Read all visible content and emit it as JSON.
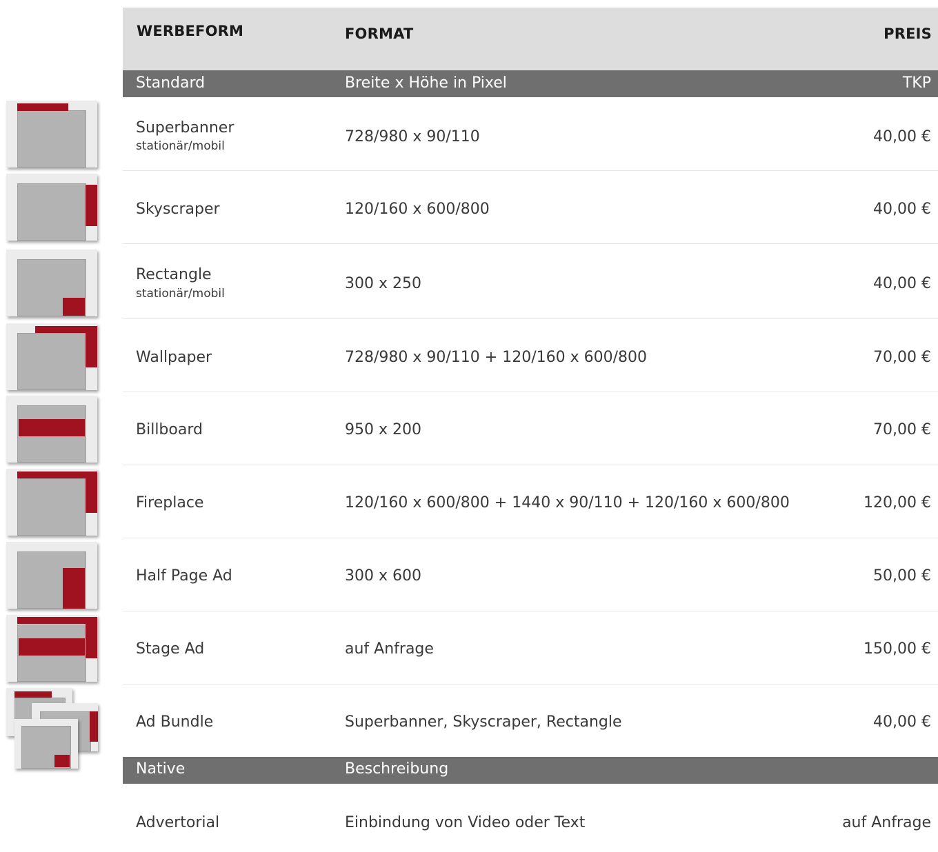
{
  "header": {
    "col1": "WERBEFORM",
    "col2": "FORMAT",
    "col3": "PREIS"
  },
  "sections": {
    "standard": {
      "label": "Standard",
      "format": "Breite x Höhe in Pixel",
      "price": "TKP"
    },
    "native": {
      "label": "Native",
      "format": "Beschreibung"
    }
  },
  "rows": [
    {
      "name": "Superbanner",
      "sub": "stationär/mobil",
      "format": "728/980 x 90/110",
      "price": "40,00 €"
    },
    {
      "name": "Skyscraper",
      "format": "120/160 x 600/800",
      "price": "40,00 €"
    },
    {
      "name": "Rectangle",
      "sub": "stationär/mobil",
      "format": "300 x 250",
      "price": "40,00 €"
    },
    {
      "name": "Wallpaper",
      "format": "728/980 x 90/110  +  120/160 x 600/800",
      "price": "70,00 €"
    },
    {
      "name": "Billboard",
      "format": "950 x 200",
      "price": "70,00 €"
    },
    {
      "name": " Fireplace",
      "format": "120/160 x 600/800  +  1440 x 90/110  +  120/160 x 600/800",
      "price": "120,00 €"
    },
    {
      "name": "Half Page Ad",
      "format": "300 x 600",
      "price": "50,00 €"
    },
    {
      "name": "Stage Ad",
      "format": "auf Anfrage",
      "price": "150,00 €"
    },
    {
      "name": "Ad Bundle",
      "format": "Superbanner, Skyscraper, Rectangle",
      "price": "40,00 €"
    }
  ],
  "native_rows": [
    {
      "name": "Advertorial",
      "format": "Einbindung von Video oder Text",
      "price": "auf Anfrage"
    }
  ],
  "colors": {
    "accent": "#a0121f",
    "header_bg": "#dcdddc",
    "section_bg": "#6f6f6f",
    "thumb_gray": "#b3b3b3"
  },
  "icons": [
    "superbanner-icon",
    "skyscraper-icon",
    "rectangle-icon",
    "wallpaper-icon",
    "billboard-icon",
    "fireplace-icon",
    "half-page-ad-icon",
    "stage-ad-icon",
    "ad-bundle-icon"
  ]
}
